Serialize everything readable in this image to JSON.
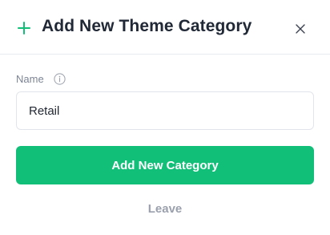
{
  "dialog": {
    "title": "Add New Theme Category",
    "plus_icon": "plus-icon",
    "close_icon": "close-icon"
  },
  "form": {
    "name_label": "Name",
    "info_icon": "info-icon",
    "name_value": "Retail"
  },
  "actions": {
    "submit_label": "Add New Category",
    "leave_label": "Leave"
  },
  "colors": {
    "accent": "#12bf78",
    "title_text": "#212836",
    "muted_text": "#9aa0ac"
  }
}
